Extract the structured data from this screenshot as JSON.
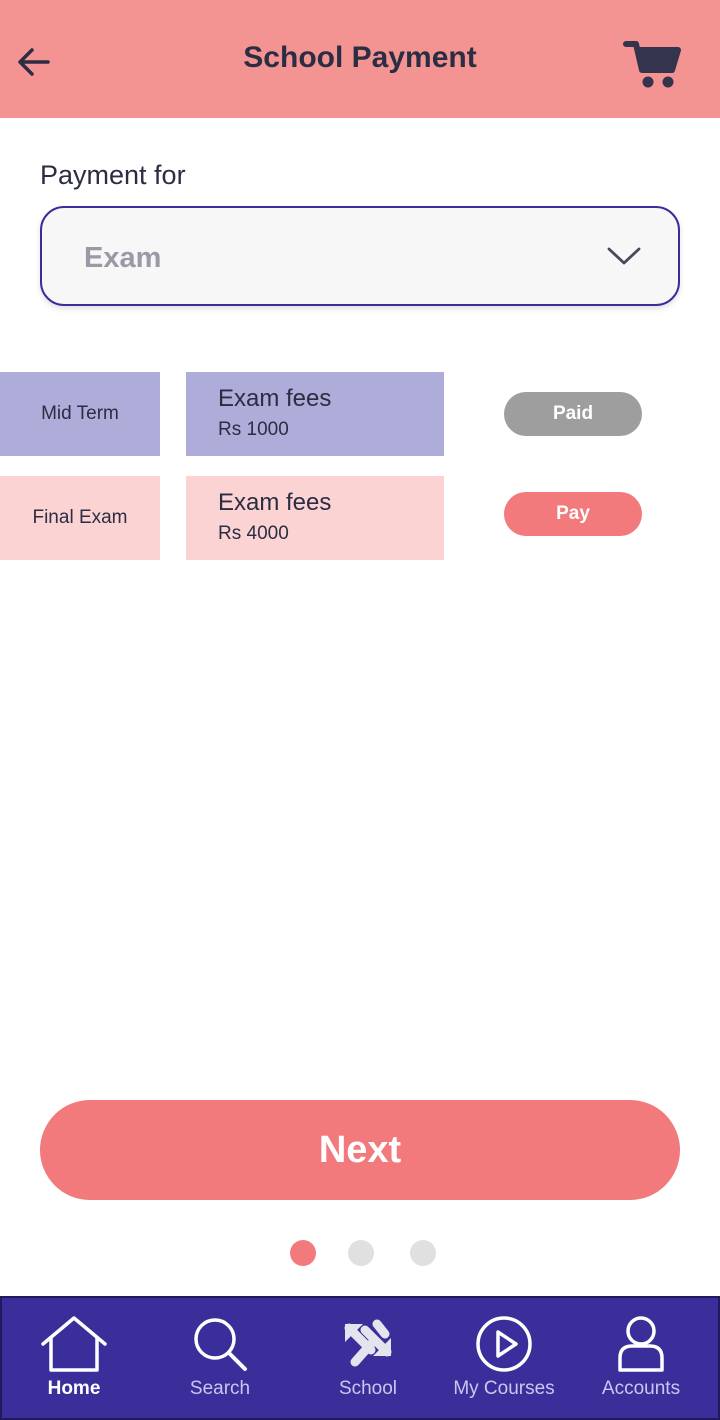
{
  "header": {
    "title": "School Payment",
    "back_icon": "arrow-left-icon",
    "cart_icon": "cart-icon"
  },
  "form": {
    "label": "Payment for",
    "selected": "Exam",
    "dropdown_icon": "chevron-down-icon"
  },
  "payments": [
    {
      "term": "Mid Term",
      "fee_title": "Exam fees",
      "amount": "Rs 1000",
      "status": "Paid"
    },
    {
      "term": "Final Exam",
      "fee_title": "Exam fees",
      "amount": "Rs 4000",
      "status": "Pay"
    }
  ],
  "next_label": "Next",
  "pagination": {
    "total": 3,
    "active": 1
  },
  "nav": {
    "items": [
      {
        "label": "Home",
        "icon": "home-icon",
        "active": true
      },
      {
        "label": "Search",
        "icon": "search-icon",
        "active": false
      },
      {
        "label": "School",
        "icon": "school-arrows-icon",
        "active": false
      },
      {
        "label": "My Courses",
        "icon": "play-circle-icon",
        "active": false
      },
      {
        "label": "Accounts",
        "icon": "user-icon",
        "active": false
      }
    ]
  },
  "colors": {
    "header_bg": "#f39493",
    "accent": "#f2797c",
    "nav_bg": "#3a2f9a",
    "row1_bg": "#aeacd8",
    "row2_bg": "#fbd3d3",
    "paid_bg": "#9e9e9e",
    "pay_bg": "#f2797c",
    "dot_inactive": "#e0e0e0"
  }
}
